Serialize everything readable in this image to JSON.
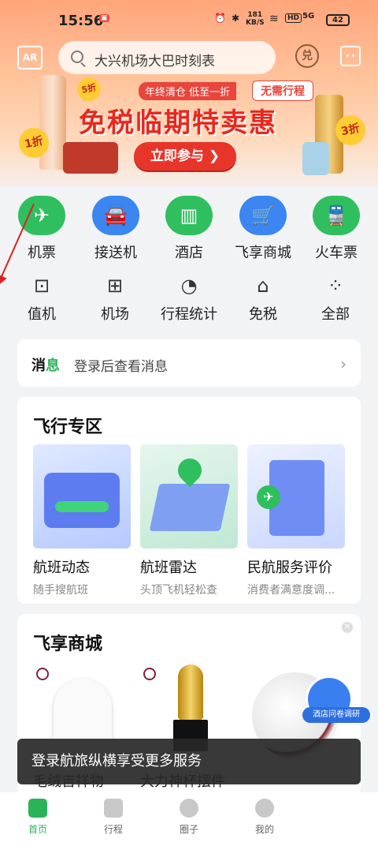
{
  "status_bar": {
    "time": "15:56",
    "speed_value": "181",
    "speed_unit": "KB/S",
    "hd": "HD",
    "network": "5G",
    "battery": "42"
  },
  "header": {
    "ar_label": "AR",
    "search_placeholder": "大兴机场大巴时刻表",
    "redeem_label": "兑"
  },
  "banner": {
    "tag_left": "年终清仓 低至一折",
    "tag_right": "无需行程",
    "title": "免税临期特卖惠",
    "cta": "立即参与",
    "badge_left": "1折",
    "badge_small": "5折",
    "badge_right": "3折"
  },
  "main_services": [
    {
      "label": "机票",
      "icon": "airplane-icon",
      "color": "#2fbf5e"
    },
    {
      "label": "接送机",
      "icon": "car-icon",
      "color": "#3b86f0"
    },
    {
      "label": "酒店",
      "icon": "hotel-icon",
      "color": "#2fbf5e"
    },
    {
      "label": "飞享商城",
      "icon": "cart-icon",
      "color": "#3b86f0"
    },
    {
      "label": "火车票",
      "icon": "train-icon",
      "color": "#2fbf5e"
    }
  ],
  "sub_services": [
    {
      "label": "值机",
      "icon": "checkin-icon"
    },
    {
      "label": "机场",
      "icon": "airport-icon"
    },
    {
      "label": "行程统计",
      "icon": "pie-chart-icon"
    },
    {
      "label": "免税",
      "icon": "dutyfree-shop-icon"
    },
    {
      "label": "全部",
      "icon": "grid-icon"
    }
  ],
  "notice": {
    "label_a": "消",
    "label_b": "息",
    "text": "登录后查看消息"
  },
  "flight_zone": {
    "title": "飞行专区",
    "items": [
      {
        "name": "航班动态",
        "sub": "随手搜航班"
      },
      {
        "name": "航班雷达",
        "sub": "头顶飞机轻松查"
      },
      {
        "name": "民航服务评价",
        "sub": "消费者满意度调..."
      }
    ]
  },
  "shop": {
    "title": "飞享商城",
    "items": [
      {
        "name": "毛绒吉祥物"
      },
      {
        "name": "大力神杯摆件"
      },
      {
        "name": ""
      }
    ]
  },
  "survey": {
    "label": "酒店问卷调研"
  },
  "toast": "登录航旅纵横享受更多服务",
  "tabs": [
    {
      "label": "首页",
      "active": true
    },
    {
      "label": "行程",
      "active": false
    },
    {
      "label": "圈子",
      "active": false
    },
    {
      "label": "我的",
      "active": false
    }
  ]
}
